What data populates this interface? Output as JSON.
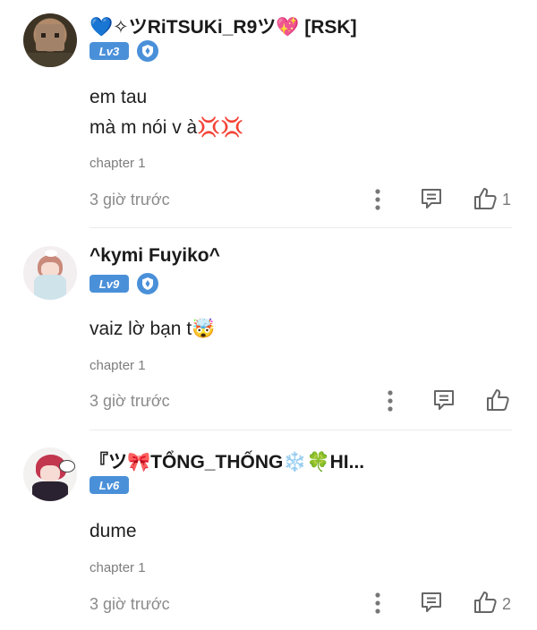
{
  "comments": [
    {
      "username": "💙✧ツRiTSUKi_R9ツ💖 [RSK]",
      "level": "Lv3",
      "lines": [
        "em tau",
        "mà m nói v à💢💢"
      ],
      "chapter": "chapter 1",
      "time": "3 giờ trước",
      "likes": "1"
    },
    {
      "username": "^kymi Fuyiko^",
      "level": "Lv9",
      "lines": [
        "vaiz lờ bạn t🤯"
      ],
      "chapter": "chapter 1",
      "time": "3 giờ trước",
      "likes": ""
    },
    {
      "username": "『ツ🎀TỔNG_THỐNG❄️🍀HI...",
      "level": "Lv6",
      "lines": [
        "dume"
      ],
      "chapter": "chapter 1",
      "time": "3 giờ trước",
      "likes": "2"
    }
  ],
  "icons": {
    "more": "more-vertical-icon",
    "reply": "reply-comment-icon",
    "like": "thumbs-up-icon",
    "shield": "shield-badge-icon"
  },
  "colors": {
    "badge": "#4a90d9",
    "muted": "#8a8a8a"
  }
}
